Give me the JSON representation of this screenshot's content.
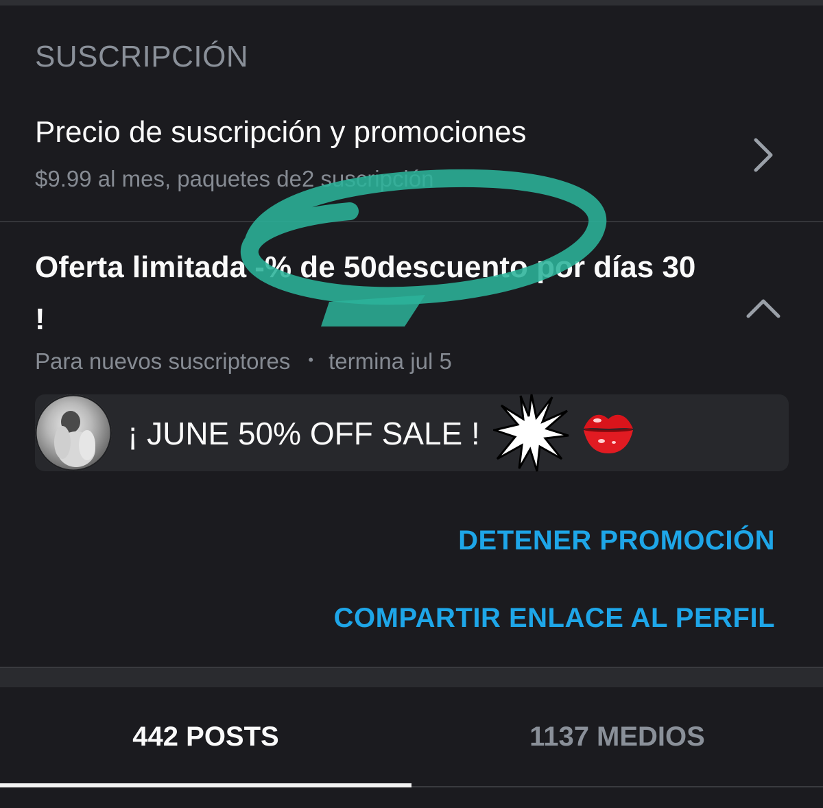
{
  "section": {
    "title": "SUSCRIPCIÓN"
  },
  "price_row": {
    "title": "Precio de suscripción y promociones",
    "subtitle": "$9.99 al mes, paquetes de2 suscripción",
    "chevron_icon": "chevron-right-icon"
  },
  "offer": {
    "title": "Oferta limitada -% de 50descuento por días 30 !",
    "audience": "Para nuevos suscriptores",
    "separator": "•",
    "ends": "termina jul 5",
    "chevron_icon": "chevron-up-icon"
  },
  "promo_card": {
    "avatar_icon": "avatar",
    "text": "¡ JUNE 50% OFF SALE !",
    "burst_icon": "starburst-icon",
    "lips_icon": "kiss-lips-icon"
  },
  "actions": {
    "stop": "DETENER PROMOCIÓN",
    "share": "COMPARTIR ENLACE AL PERFIL"
  },
  "tabs": [
    {
      "label": "442 POSTS",
      "active": true
    },
    {
      "label": "1137 MEDIOS",
      "active": false
    }
  ],
  "colors": {
    "background": "#1b1b1f",
    "accent": "#1ea6e8",
    "muted": "#868b93",
    "card": "#27282c",
    "annotation": "#2bb39a"
  }
}
